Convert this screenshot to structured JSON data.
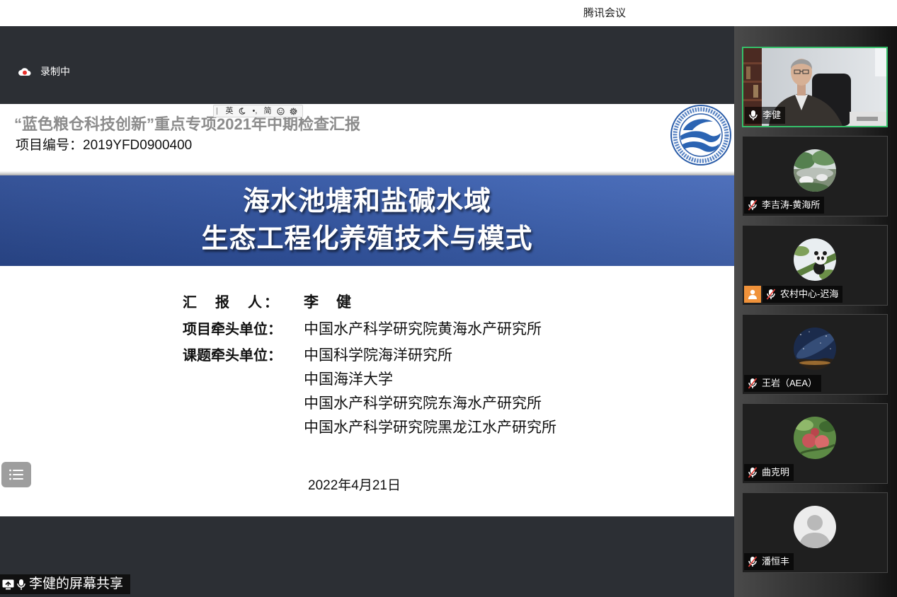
{
  "window": {
    "title": "腾讯会议"
  },
  "recording": {
    "label": "录制中"
  },
  "ime_toolbar": {
    "lang_label": "英",
    "punct_label": "•,",
    "script_label": "简"
  },
  "slide": {
    "header_title": "“蓝色粮仓科技创新”重点专项2021年中期检查汇报",
    "project_number": "项目编号：2019YFD0900400",
    "banner": {
      "line1": "海水池塘和盐碱水域",
      "line2": "生态工程化养殖技术与模式"
    },
    "reporter": {
      "label": "汇　报　人：",
      "value": "李　健"
    },
    "lead_unit": {
      "label": "项目牵头单位：",
      "value": "中国水产科学研究院黄海水产研究所"
    },
    "topic_units": {
      "label": "课题牵头单位：",
      "values": [
        "中国科学院海洋研究所",
        "中国海洋大学",
        "中国水产科学研究院东海水产研究所",
        "中国水产科学研究院黑龙江水产研究所"
      ]
    },
    "date": "2022年4月21日"
  },
  "share_status": {
    "label": "李健的屏幕共享"
  },
  "participants": [
    {
      "name": "李健",
      "muted": false,
      "has_video": true,
      "active_speaker": true
    },
    {
      "name": "李吉涛-黄海所",
      "muted": true,
      "avatar": "landscape-avatar"
    },
    {
      "name": "农村中心-迟海",
      "muted": true,
      "avatar": "panda-avatar",
      "badge_icon": "person-icon"
    },
    {
      "name": "王岩（AEA）",
      "muted": true,
      "avatar": "night-sky-avatar"
    },
    {
      "name": "曲克明",
      "muted": true,
      "avatar": "fruit-avatar"
    },
    {
      "name": "潘恒丰",
      "muted": true,
      "avatar": "default-person-avatar"
    }
  ],
  "icons": {
    "recording": "recording-icon",
    "ime_mode": "moon-icon",
    "ime_emoji": "emoji-icon",
    "ime_settings": "gear-icon",
    "slide_menu": "list-icon",
    "share": "screen-share-icon",
    "mic_on": "mic-icon",
    "mic_muted": "mic-muted-icon"
  },
  "colors": {
    "active_speaker_border": "#35c06a",
    "banner_blue": "#3559a7",
    "muted_red": "#e5413b",
    "recording_red": "#e8302c",
    "badge_orange": "#f0923a"
  }
}
